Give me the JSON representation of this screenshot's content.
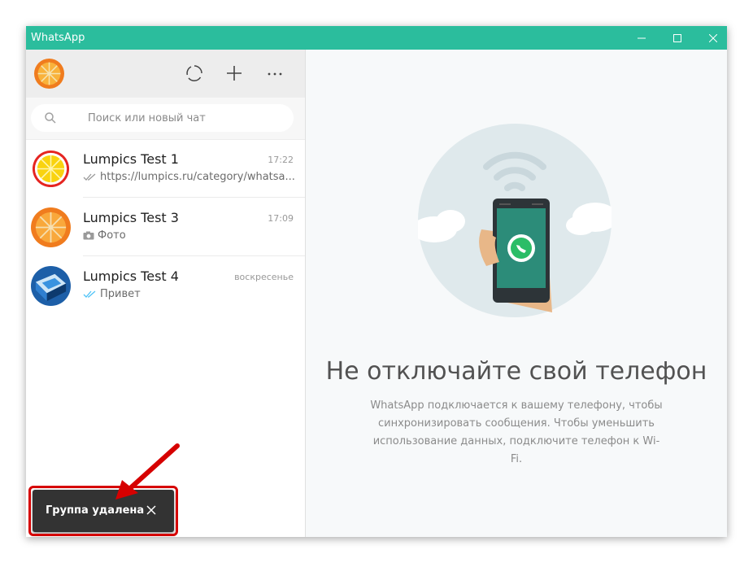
{
  "window": {
    "title": "WhatsApp"
  },
  "search": {
    "placeholder": "Поиск или новый чат"
  },
  "chats": [
    {
      "name": "Lumpics Test 1",
      "time": "17:22",
      "preview": "https://lumpics.ru/category/whatsa...",
      "status_icon": "double-check-gray-icon",
      "avatar": "lemon-avatar"
    },
    {
      "name": "Lumpics Test 3",
      "time": "17:09",
      "preview": "Фото",
      "status_icon": "camera-icon",
      "avatar": "orange-avatar"
    },
    {
      "name": "Lumpics Test 4",
      "time": "воскресенье",
      "preview": "Привет",
      "status_icon": "double-check-blue-icon",
      "avatar": "blue-cube-avatar"
    }
  ],
  "main": {
    "title": "Не отключайте свой телефон",
    "description": "WhatsApp подключается к вашему телефону, чтобы синхронизировать сообщения. Чтобы уменьшить использование данных, подключите телефон к Wi-Fi."
  },
  "toast": {
    "text": "Группа удалена"
  },
  "colors": {
    "titlebar": "#2bbd9d",
    "highlight": "#d60000",
    "read_ticks": "#4fc3f7"
  }
}
